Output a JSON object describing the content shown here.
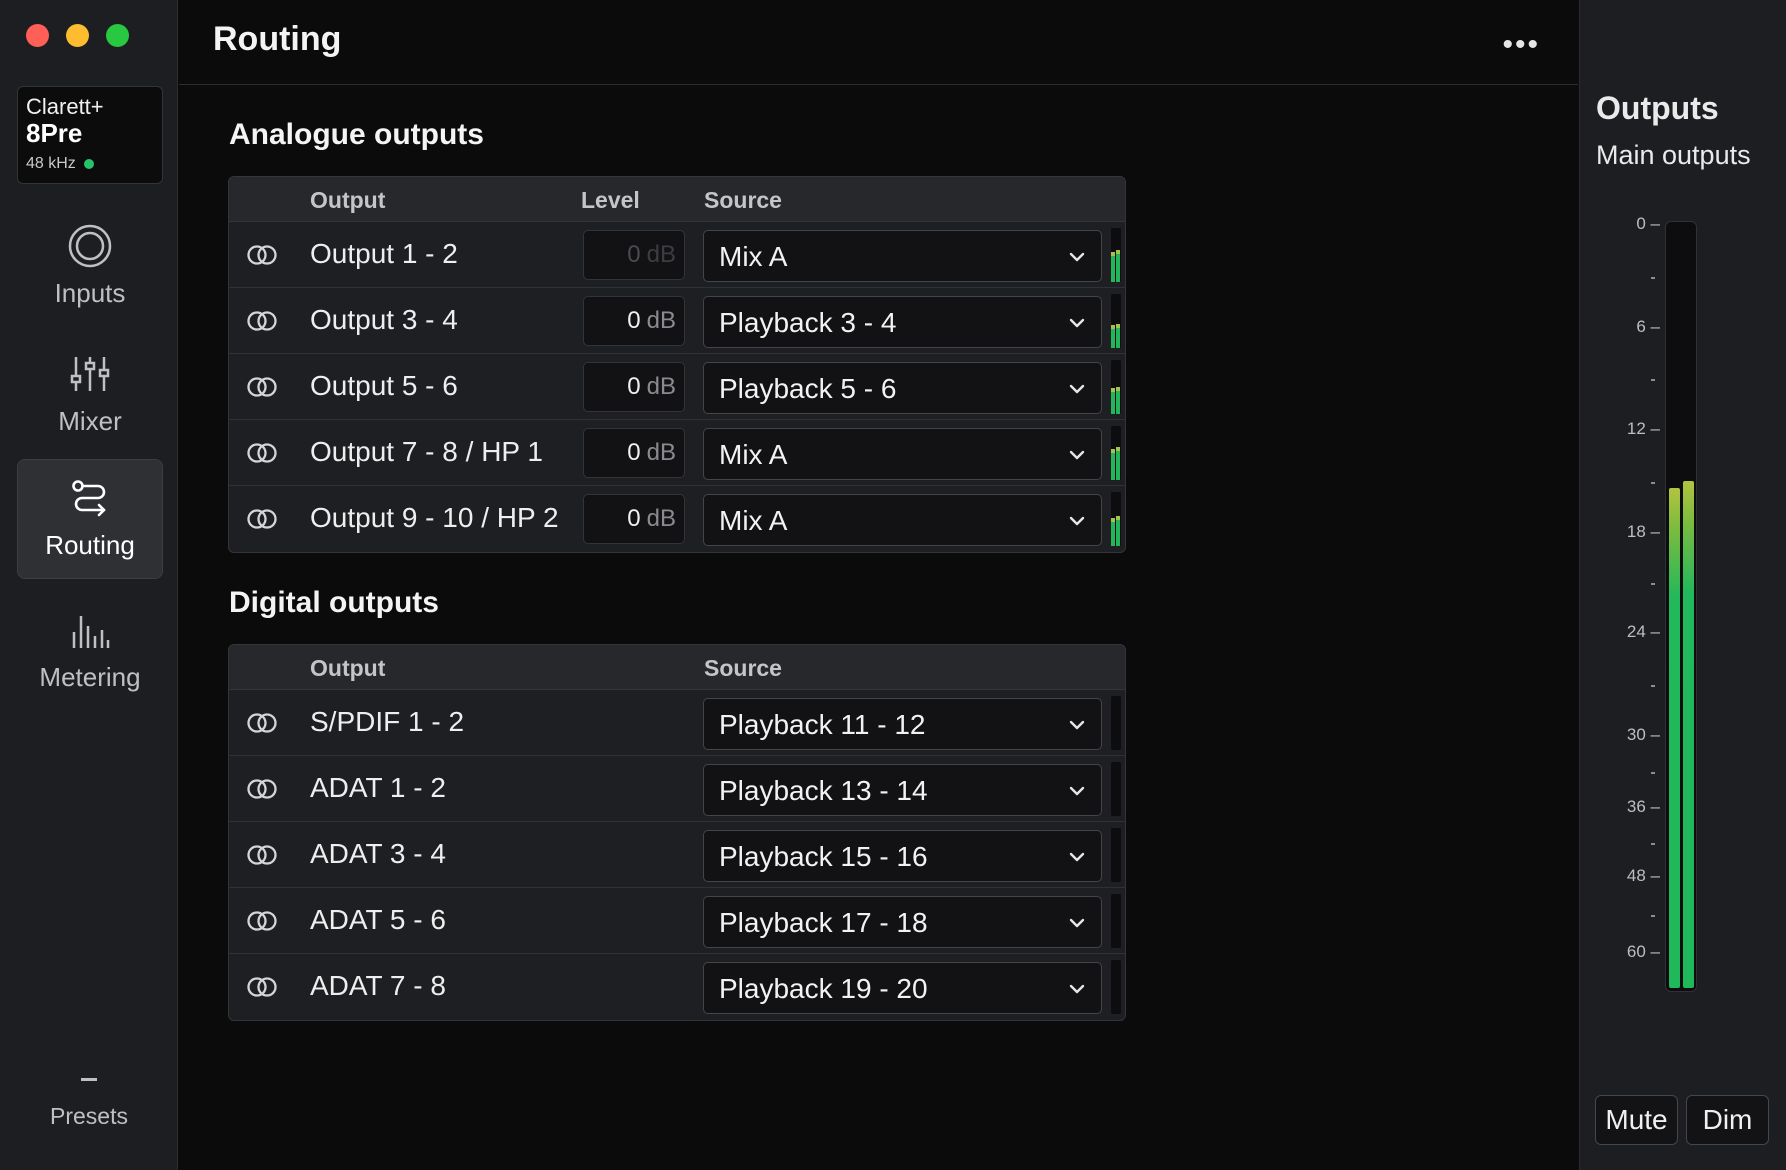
{
  "window": {
    "title": "Routing"
  },
  "device": {
    "brand": "Clarett+",
    "model": "8Pre",
    "sample_rate": "48 kHz",
    "status_color": "#25c36a"
  },
  "nav": {
    "inputs": "Inputs",
    "mixer": "Mixer",
    "routing": "Routing",
    "metering": "Metering",
    "presets": "Presets",
    "active": "routing"
  },
  "header": {
    "title": "Routing",
    "more_icon": "ellipsis-icon"
  },
  "analogue": {
    "title": "Analogue outputs",
    "headers": {
      "output": "Output",
      "level": "Level",
      "source": "Source"
    },
    "rows": [
      {
        "output": "Output 1 - 2",
        "level": "0",
        "unit": "dB",
        "level_enabled": false,
        "source": "Mix A",
        "meter_l": 0.55,
        "meter_r": 0.6
      },
      {
        "output": "Output 3 - 4",
        "level": "0",
        "unit": "dB",
        "level_enabled": true,
        "source": "Playback 3 - 4",
        "meter_l": 0.42,
        "meter_r": 0.45
      },
      {
        "output": "Output 5 - 6",
        "level": "0",
        "unit": "dB",
        "level_enabled": true,
        "source": "Playback 5 - 6",
        "meter_l": 0.48,
        "meter_r": 0.5
      },
      {
        "output": "Output 7 - 8 / HP 1",
        "level": "0",
        "unit": "dB",
        "level_enabled": true,
        "source": "Mix A",
        "meter_l": 0.58,
        "meter_r": 0.62
      },
      {
        "output": "Output 9 - 10 / HP 2",
        "level": "0",
        "unit": "dB",
        "level_enabled": true,
        "source": "Mix A",
        "meter_l": 0.52,
        "meter_r": 0.56
      }
    ]
  },
  "digital": {
    "title": "Digital outputs",
    "headers": {
      "output": "Output",
      "source": "Source"
    },
    "rows": [
      {
        "output": "S/PDIF 1 - 2",
        "source": "Playback 11 - 12"
      },
      {
        "output": "ADAT 1 - 2",
        "source": "Playback 13 - 14"
      },
      {
        "output": "ADAT 3 - 4",
        "source": "Playback 15 - 16"
      },
      {
        "output": "ADAT 5 - 6",
        "source": "Playback 17 - 18"
      },
      {
        "output": "ADAT 7 - 8",
        "source": "Playback 19 - 20"
      }
    ]
  },
  "outputs_panel": {
    "title": "Outputs",
    "subtitle": "Main outputs",
    "scale": [
      "0",
      "6",
      "12",
      "18",
      "24",
      "30",
      "36",
      "48",
      "60"
    ],
    "meter_left": 0.655,
    "meter_right": 0.665,
    "mute_label": "Mute",
    "dim_label": "Dim"
  },
  "colors": {
    "accent_green": "#22b55a",
    "meter_peak": "#b2c440"
  }
}
